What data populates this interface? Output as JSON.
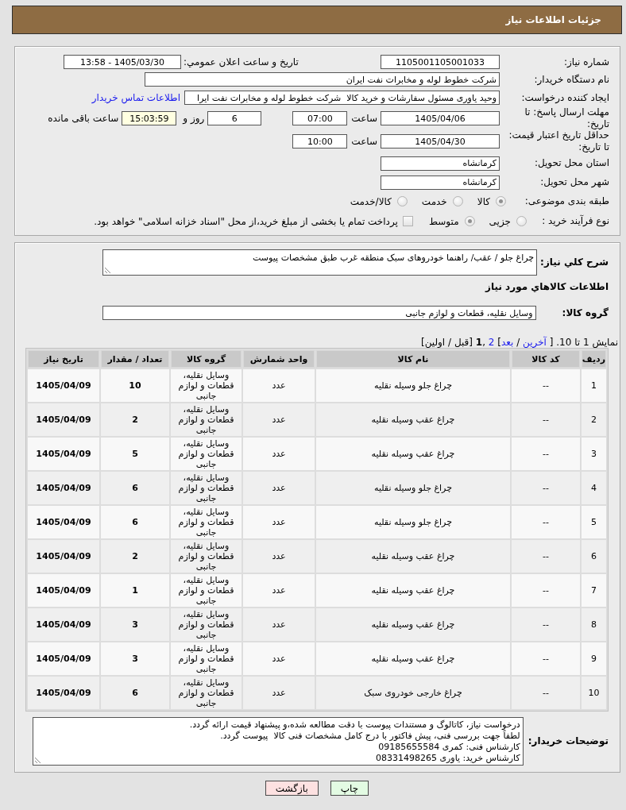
{
  "header": {
    "title": "جزئیات اطلاعات نیاز"
  },
  "details": {
    "need_number": {
      "label": "شماره نیاز:",
      "value": "1105001105001033"
    },
    "announced": {
      "label": "تاریخ و ساعت اعلان عمومي:",
      "value": "1405/03/30 - 13:58"
    },
    "buyer": {
      "label": "نام دستگاه خریدار:",
      "value": "شرکت خطوط لوله و مخابرات نفت ایران"
    },
    "requester": {
      "label": "ایجاد کننده درخواست:",
      "value": "وحید یاوری مسئول سفارشات و خرید کالا  شرکت خطوط لوله و مخابرات نفت ایرا",
      "contact_link": "اطلاعات تماس خریدار"
    },
    "reply_deadline": {
      "label": "مهلت ارسال پاسخ: تا تاریخ:",
      "date": "1405/04/06",
      "time_label": "ساعت",
      "time": "07:00",
      "days": "6",
      "days_label": "روز و",
      "remaining": "15:03:59",
      "remaining_label": "ساعت باقی مانده"
    },
    "price_validity": {
      "label": "حداقل تاریخ اعتبار قیمت: تا تاریخ:",
      "date": "1405/04/30",
      "time_label": "ساعت",
      "time": "10:00"
    },
    "province": {
      "label": "استان محل تحویل:",
      "value": "کرمانشاه"
    },
    "city": {
      "label": "شهر محل تحویل:",
      "value": "کرمانشاه"
    },
    "category": {
      "label": "طبقه بندی موضوعی:",
      "options": [
        {
          "label": "کالا",
          "selected": true
        },
        {
          "label": "خدمت",
          "selected": false
        },
        {
          "label": "کالا/خدمت",
          "selected": false
        }
      ]
    },
    "process": {
      "label": "نوع فرآیند خرید :",
      "options": [
        {
          "label": "جزیی",
          "selected": false
        },
        {
          "label": "متوسط",
          "selected": true
        }
      ],
      "treasury": {
        "label": "پرداخت تمام یا بخشی از مبلغ خرید،از محل \"اسناد خزانه اسلامی\" خواهد بود.",
        "checked": false
      }
    }
  },
  "summary": {
    "label": "شرح کلي نیاز:",
    "value": "چراغ جلو / عقب/ راهنما خودروهای سبک منطقه غرب طبق مشخصات پیوست"
  },
  "goods": {
    "title": "اطلاعات کالاهاي مورد نیاز",
    "group": {
      "label": "گروه کالا:",
      "value": "وسایل نقلیه، قطعات و لوازم جانبی"
    },
    "pager": [
      {
        "kind": "text",
        "text": "نمایش 1 تا 10. [ "
      },
      {
        "kind": "link",
        "text": "آخرین"
      },
      {
        "kind": "text",
        "text": " / "
      },
      {
        "kind": "link",
        "text": "بعد"
      },
      {
        "kind": "text",
        "text": "] "
      },
      {
        "kind": "link",
        "text": "2"
      },
      {
        "kind": "text",
        "text": " ,"
      },
      {
        "kind": "current",
        "text": "1"
      },
      {
        "kind": "text",
        "text": " [قبل / اولین]"
      }
    ],
    "table": {
      "columns": [
        "ردیف",
        "کد کالا",
        "نام کالا",
        "واحد شمارش",
        "گروه کالا",
        "تعداد / مقدار",
        "تاریخ نیاز"
      ],
      "rows": [
        {
          "cells": [
            "1",
            "--",
            "چراغ جلو وسیله نقلیه",
            "عدد",
            "وسایل نقلیه، قطعات و لوازم جانبی",
            "10",
            "1405/04/09"
          ]
        },
        {
          "cells": [
            "2",
            "--",
            "چراغ عقب وسیله نقلیه",
            "عدد",
            "وسایل نقلیه، قطعات و لوازم جانبی",
            "2",
            "1405/04/09"
          ]
        },
        {
          "cells": [
            "3",
            "--",
            "چراغ عقب وسیله نقلیه",
            "عدد",
            "وسایل نقلیه، قطعات و لوازم جانبی",
            "5",
            "1405/04/09"
          ]
        },
        {
          "cells": [
            "4",
            "--",
            "چراغ جلو وسیله نقلیه",
            "عدد",
            "وسایل نقلیه، قطعات و لوازم جانبی",
            "6",
            "1405/04/09"
          ]
        },
        {
          "cells": [
            "5",
            "--",
            "چراغ جلو وسیله نقلیه",
            "عدد",
            "وسایل نقلیه، قطعات و لوازم جانبی",
            "6",
            "1405/04/09"
          ]
        },
        {
          "cells": [
            "6",
            "--",
            "چراغ عقب وسیله نقلیه",
            "عدد",
            "وسایل نقلیه، قطعات و لوازم جانبی",
            "2",
            "1405/04/09"
          ]
        },
        {
          "cells": [
            "7",
            "--",
            "چراغ عقب وسیله نقلیه",
            "عدد",
            "وسایل نقلیه، قطعات و لوازم جانبی",
            "1",
            "1405/04/09"
          ]
        },
        {
          "cells": [
            "8",
            "--",
            "چراغ عقب وسیله نقلیه",
            "عدد",
            "وسایل نقلیه، قطعات و لوازم جانبی",
            "3",
            "1405/04/09"
          ]
        },
        {
          "cells": [
            "9",
            "--",
            "چراغ عقب وسیله نقلیه",
            "عدد",
            "وسایل نقلیه، قطعات و لوازم جانبی",
            "3",
            "1405/04/09"
          ]
        },
        {
          "cells": [
            "10",
            "--",
            "چراغ خارجی خودروی سبک",
            "عدد",
            "وسایل نقلیه، قطعات و لوازم جانبی",
            "6",
            "1405/04/09"
          ]
        }
      ]
    }
  },
  "buyer_notes": {
    "label": "توضیحات خریدار:",
    "value": "درخواست نیاز، کاتالوگ و مستندات پیوست با دقت مطالعه شده،و پیشنهاد قیمت ارائه گردد.\nلطفاً جهت بررسی فنی، پیش فاکتور با درج کامل مشخصات فنی کالا  پیوست گردد.\nکارشناس فنی: کمری 09185655584\nکارشناس خرید: یاوری 08331498265"
  },
  "buttons": [
    {
      "label": "چاپ",
      "kind": "print"
    },
    {
      "label": "بازگشت",
      "kind": "back"
    }
  ]
}
